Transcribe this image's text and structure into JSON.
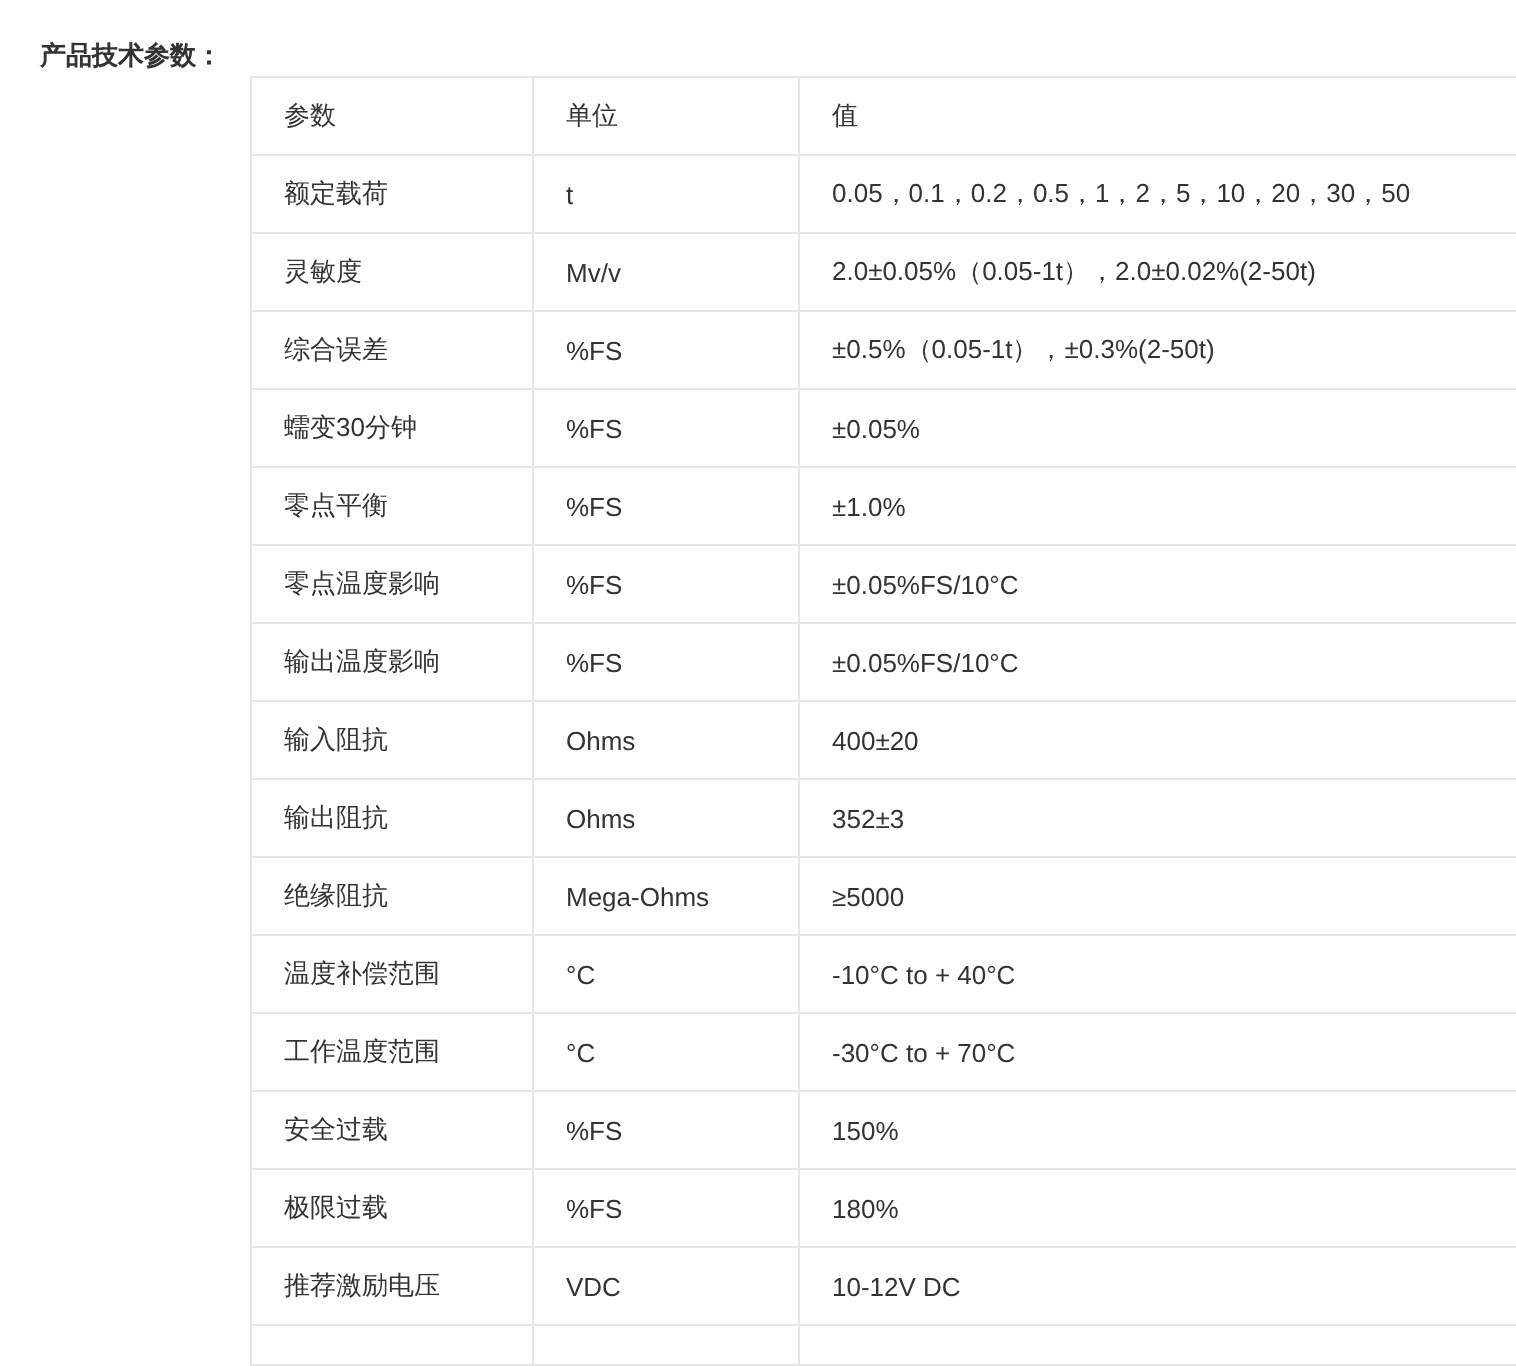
{
  "heading": "产品技术参数：",
  "table": {
    "columns": [
      "参数",
      "单位",
      "值"
    ],
    "rows": [
      [
        "额定载荷",
        "t",
        "0.05，0.1，0.2，0.5，1，2，5，10，20，30，50"
      ],
      [
        "灵敏度",
        "Mv/v",
        "2.0±0.05%（0.05-1t），2.0±0.02%(2-50t)"
      ],
      [
        "综合误差",
        "%FS",
        "±0.5%（0.05-1t），±0.3%(2-50t)"
      ],
      [
        "蠕变30分钟",
        "%FS",
        "±0.05%"
      ],
      [
        "零点平衡",
        "%FS",
        "±1.0%"
      ],
      [
        "零点温度影响",
        "%FS",
        "±0.05%FS/10°C"
      ],
      [
        "输出温度影响",
        "%FS",
        "±0.05%FS/10°C"
      ],
      [
        "输入阻抗",
        "Ohms",
        "400±20"
      ],
      [
        "输出阻抗",
        "Ohms",
        "352±3"
      ],
      [
        "绝缘阻抗",
        "Mega-Ohms",
        "≥5000"
      ],
      [
        "温度补偿范围",
        "°C",
        "-10°C to + 40°C"
      ],
      [
        "工作温度范围",
        "°C",
        "-30°C to + 70°C"
      ],
      [
        "安全过载",
        "%FS",
        "150%"
      ],
      [
        "极限过载",
        "%FS",
        "180%"
      ],
      [
        "推荐激励电压",
        "VDC",
        "10-12V DC"
      ]
    ]
  }
}
